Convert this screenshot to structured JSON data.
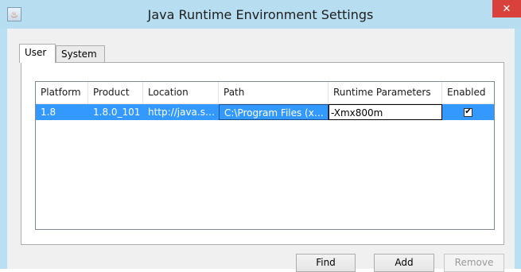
{
  "window": {
    "title": "Java Runtime Environment Settings",
    "close_glyph": "✕",
    "app_icon_glyph": "♨"
  },
  "tabs": [
    {
      "label": "User",
      "active": true
    },
    {
      "label": "System",
      "active": false
    }
  ],
  "table": {
    "columns": [
      "Platform",
      "Product",
      "Location",
      "Path",
      "Runtime Parameters",
      "Enabled"
    ],
    "rows": [
      {
        "platform": "1.8",
        "product": "1.8.0_101",
        "location": "http://java.s…",
        "path": "C:\\Program Files (x8…",
        "runtime_parameters": "-Xmx800m",
        "enabled": true,
        "enabled_glyph": "✔"
      }
    ],
    "selection_color": "#3399ff"
  },
  "buttons": {
    "find": "Find",
    "add": "Add",
    "remove": "Remove"
  }
}
